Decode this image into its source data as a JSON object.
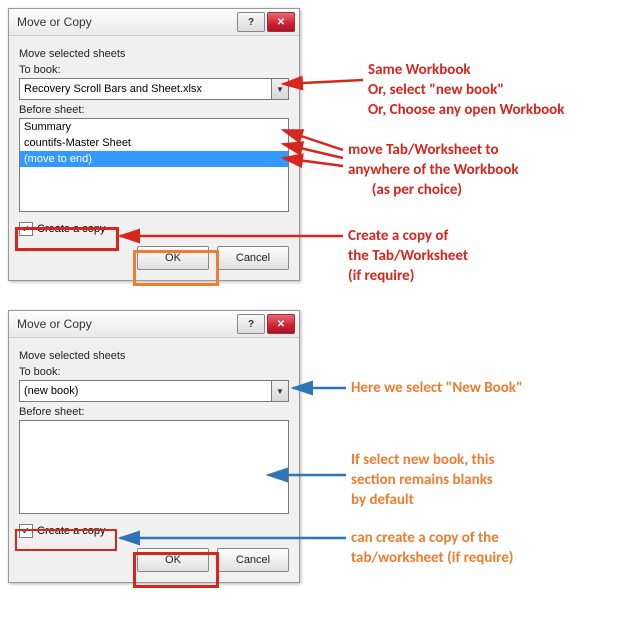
{
  "dialog1": {
    "title": "Move or Copy",
    "instruction": "Move selected sheets",
    "to_book_label": "To book:",
    "to_book_value": "Recovery Scroll Bars and Sheet.xlsx",
    "before_label": "Before sheet:",
    "list": [
      "Summary",
      "countifs-Master Sheet",
      "(move to end)"
    ],
    "selected_index": 2,
    "copy_label": "Create a copy",
    "copy_checked": true,
    "ok": "OK",
    "cancel": "Cancel",
    "help_glyph": "?",
    "close_glyph": "✕",
    "dropdown_glyph": "▼",
    "check_glyph": "✓"
  },
  "dialog2": {
    "title": "Move or Copy",
    "instruction": "Move selected sheets",
    "to_book_label": "To book:",
    "to_book_value": "(new book)",
    "before_label": "Before sheet:",
    "copy_label": "Create a copy",
    "copy_checked": true,
    "ok": "OK",
    "cancel": "Cancel",
    "help_glyph": "?",
    "close_glyph": "✕",
    "dropdown_glyph": "▼",
    "check_glyph": "✓"
  },
  "annotations": {
    "a1": "Same Workbook\nOr, select \"new book\"\nOr, Choose any open Workbook",
    "a2": "move Tab/Worksheet to\nanywhere of the Workbook\n       (as per choice)",
    "a3": "Create a copy of\nthe Tab/Worksheet\n(if require)",
    "a4": "Here we select \"New Book\"",
    "a5": "If select new book, this\nsection remains blanks\nby default",
    "a6": "can create a copy of the\ntab/worksheet (if require)"
  }
}
